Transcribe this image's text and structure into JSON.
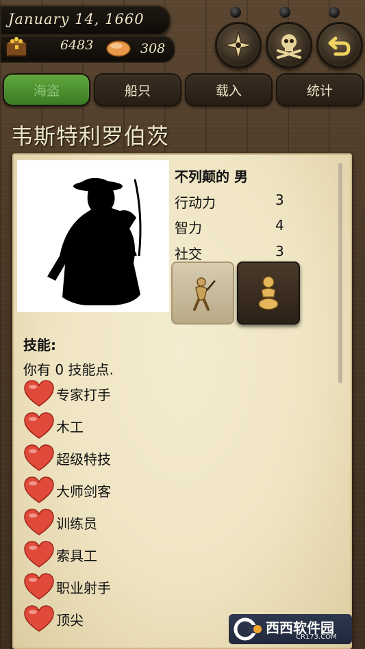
{
  "header": {
    "date": "January 14, 1660",
    "gold": "6483",
    "food": "308",
    "buttons": [
      {
        "icon": "compass-icon"
      },
      {
        "icon": "skull-crossbones-icon"
      },
      {
        "icon": "back-arrow-icon"
      }
    ]
  },
  "tabs": [
    {
      "label": "海盗",
      "active": true
    },
    {
      "label": "船只",
      "active": false
    },
    {
      "label": "载入",
      "active": false
    },
    {
      "label": "统计",
      "active": false
    }
  ],
  "pirate": {
    "name": "韦斯特利罗伯茨",
    "descriptor": "不列颠的 男",
    "stats": [
      {
        "label": "行动力",
        "value": "3"
      },
      {
        "label": "智力",
        "value": "4"
      },
      {
        "label": "社交",
        "value": "3"
      }
    ]
  },
  "skills": {
    "header": "技能:",
    "points_text": "你有 0 技能点.",
    "items": [
      "专家打手",
      "木工",
      "超级特技",
      "大师剑客",
      "训练员",
      "索具工",
      "职业射手",
      "顶尖"
    ]
  },
  "watermark": {
    "main": "西西软件园",
    "sub": "CR173.COM"
  },
  "colors": {
    "active_tab": "#5fa83d",
    "heart": "#e04a3a",
    "parchment": "#efe4c2"
  }
}
